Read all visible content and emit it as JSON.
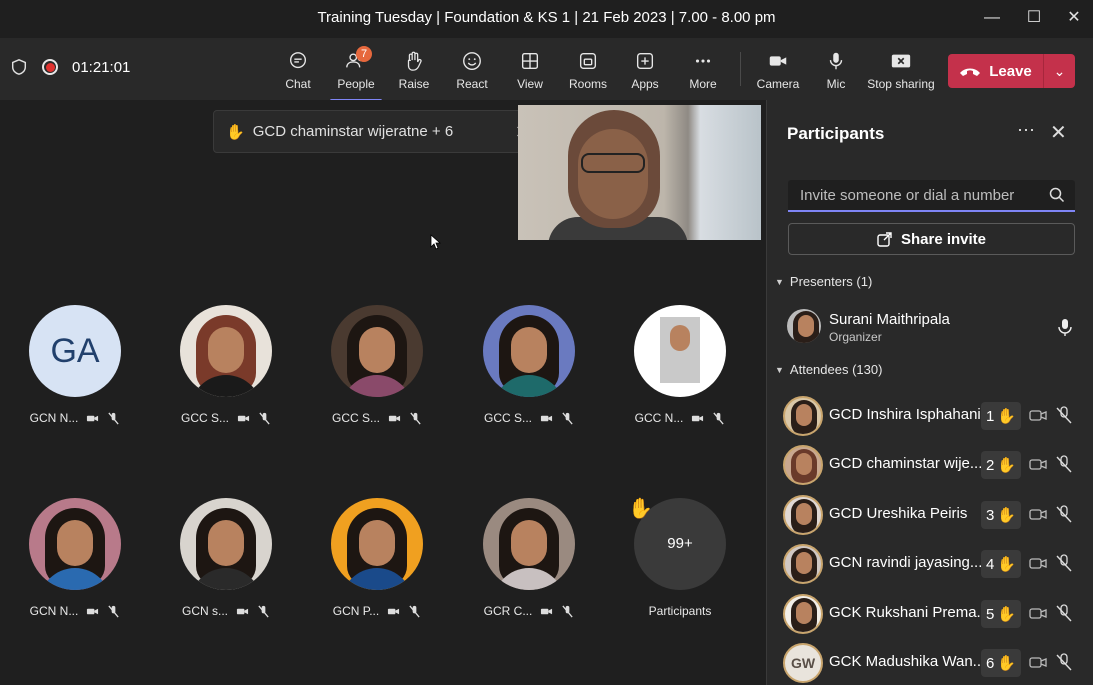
{
  "window": {
    "title": "Training Tuesday | Foundation & KS 1 | 21 Feb 2023 | 7.00 - 8.00 pm"
  },
  "toolbar": {
    "timer": "01:21:01",
    "buttons": [
      {
        "label": "Chat",
        "icon": "chat-icon"
      },
      {
        "label": "People",
        "icon": "people-icon",
        "badge": "7"
      },
      {
        "label": "Raise",
        "icon": "raise-hand-icon"
      },
      {
        "label": "React",
        "icon": "smiley-icon"
      },
      {
        "label": "View",
        "icon": "grid-view-icon"
      },
      {
        "label": "Rooms",
        "icon": "rooms-icon"
      },
      {
        "label": "Apps",
        "icon": "apps-icon"
      },
      {
        "label": "More",
        "icon": "ellipsis-icon"
      },
      {
        "label": "Camera",
        "icon": "camera-icon"
      },
      {
        "label": "Mic",
        "icon": "mic-icon"
      },
      {
        "label": "Stop sharing",
        "icon": "stop-share-icon"
      }
    ],
    "leave_label": "Leave"
  },
  "toast": {
    "text": "GCD chaminstar wijeratne + 6"
  },
  "tiles": [
    {
      "name": "GCN N...",
      "initials": "GA"
    },
    {
      "name": "GCC S..."
    },
    {
      "name": "GCC S..."
    },
    {
      "name": "GCC S..."
    },
    {
      "name": "GCC N..."
    },
    {
      "name": "GCN N..."
    },
    {
      "name": "GCN s..."
    },
    {
      "name": "GCN P..."
    },
    {
      "name": "GCR C..."
    }
  ],
  "overflow_tile": {
    "count": "99+",
    "label": "Participants"
  },
  "panel": {
    "title": "Participants",
    "search_placeholder": "Invite someone or dial a number",
    "share_label": "Share invite",
    "presenters_label": "Presenters (1)",
    "attendees_label": "Attendees (130)",
    "presenter": {
      "name": "Surani Maithripala",
      "role": "Organizer"
    },
    "attendees": [
      {
        "name": "GCD Inshira Isphahani",
        "queue": "1"
      },
      {
        "name": "GCD chaminstar wije...",
        "queue": "2"
      },
      {
        "name": "GCD Ureshika Peiris",
        "queue": "3"
      },
      {
        "name": "GCN ravindi jayasing...",
        "queue": "4"
      },
      {
        "name": "GCK Rukshani Prema...",
        "queue": "5"
      },
      {
        "name": "GCK Madushika Wan...",
        "queue": "6",
        "initials": "GW"
      }
    ]
  },
  "colors": {
    "accent": "#7f85f5",
    "leave": "#c4314b",
    "badge": "#e6683d"
  }
}
